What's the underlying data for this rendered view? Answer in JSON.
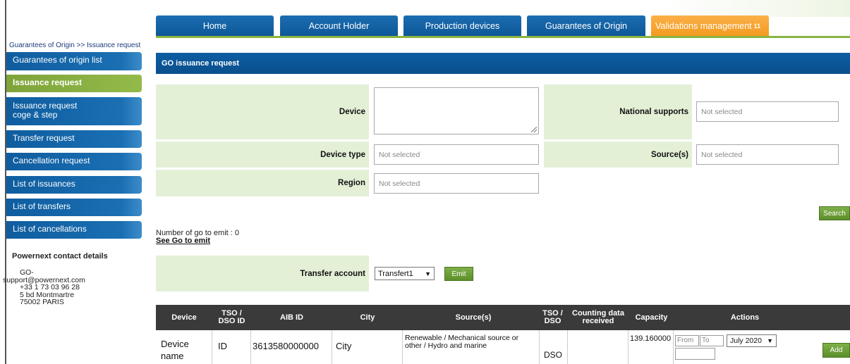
{
  "nav": {
    "tabs": [
      {
        "label": "Home"
      },
      {
        "label": "Account Holder"
      },
      {
        "label": "Production devices"
      },
      {
        "label": "Guarantees of Origin"
      },
      {
        "label": "Validations management",
        "badge": "11"
      }
    ]
  },
  "breadcrumb": "Guarantees of Origin >> Issuance request",
  "sidebar": {
    "items": [
      {
        "label": "Guarantees of origin list"
      },
      {
        "label": "Issuance request"
      },
      {
        "label": "Issuance request",
        "label2": "coge & step"
      },
      {
        "label": "Transfer request"
      },
      {
        "label": "Cancellation request"
      },
      {
        "label": "List of issuances"
      },
      {
        "label": "List of transfers"
      },
      {
        "label": "List of cancellations"
      }
    ],
    "contact": {
      "title": "Powernext contact details",
      "lines": [
        "GO-",
        "support@powernext.com",
        "+33 1 73 03 96 28",
        "5 bd Montmartre",
        "75002 PARIS"
      ]
    }
  },
  "panel": {
    "title": "GO issuance request",
    "device_label": "Device",
    "device_type_label": "Device type",
    "device_type_placeholder": "Not selected",
    "region_label": "Region",
    "region_placeholder": "Not selected",
    "national_supports_label": "National supports",
    "national_supports_placeholder": "Not selected",
    "sources_label": "Source(s)",
    "sources_placeholder": "Not selected",
    "search_button": "Search"
  },
  "emit": {
    "count_text": "Number of go to emit : 0",
    "see_link": "See Go to emit",
    "transfer_account_label": "Transfer account",
    "transfer_account_value": "Transfert1",
    "emit_button": "Emit"
  },
  "table": {
    "headers": [
      "Device",
      "TSO / DSO ID",
      "AIB ID",
      "City",
      "Source(s)",
      "TSO / DSO",
      "Counting data received",
      "Capacity",
      "Actions"
    ],
    "row": {
      "device": "Device name",
      "tso_dso_id": "ID",
      "aib_id": "3613580000000",
      "city": "City",
      "sources": "Renewable / Mechanical source or other / Hydro and marine",
      "tso_dso": "DSO",
      "counting": "",
      "capacity": "139.160000",
      "from_placeholder": "From",
      "to_placeholder": "To",
      "month": "July 2020",
      "add_button": "Add"
    }
  },
  "colors": {
    "nav_blue": "#1466aa",
    "active_orange": "#f5a12a",
    "active_green": "#8ab442",
    "label_bg": "#e4f0d6",
    "table_header": "#3a3a3a"
  }
}
